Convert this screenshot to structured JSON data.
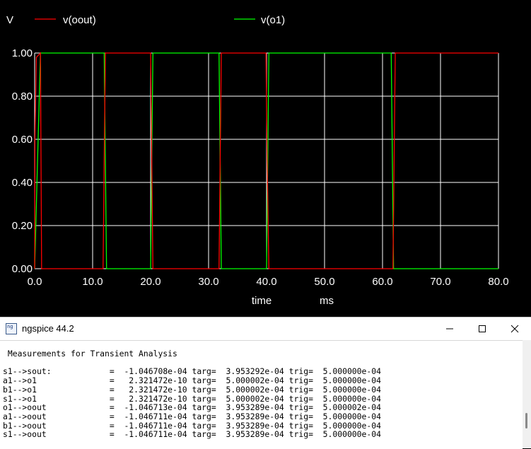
{
  "plot": {
    "y_unit": "V",
    "xlabel": "time",
    "xunit": "ms",
    "legend": [
      {
        "name": "v(oout)",
        "color": "#ff0000"
      },
      {
        "name": "v(o1)",
        "color": "#00ff00"
      }
    ],
    "yticks": [
      "1.00",
      "0.80",
      "0.60",
      "0.40",
      "0.20",
      "0.00"
    ],
    "xticks": [
      "0.0",
      "10.0",
      "20.0",
      "30.0",
      "40.0",
      "50.0",
      "60.0",
      "70.0",
      "80.0"
    ]
  },
  "chart_data": {
    "type": "line",
    "title": "",
    "xlabel": "time",
    "xunit": "ms",
    "ylabel": "V",
    "xlim": [
      0,
      80
    ],
    "ylim": [
      0,
      1
    ],
    "grid": true,
    "legend_position": "top",
    "series": [
      {
        "name": "v(oout)",
        "color": "#ff0000",
        "x": [
          0,
          0.05,
          0.3,
          1.0,
          1.2,
          11.8,
          12.0,
          12.2,
          20.0,
          20.2,
          20.4,
          31.8,
          32.0,
          32.2,
          39.9,
          40.1,
          40.4,
          61.8,
          62.0,
          62.2,
          70.0,
          80.0
        ],
        "y": [
          0,
          0.6,
          0.98,
          1.0,
          0.0,
          0.0,
          0.5,
          1.0,
          1.0,
          0.5,
          0.0,
          0.0,
          0.5,
          1.0,
          1.0,
          0.5,
          0.0,
          0.0,
          0.5,
          1.0,
          1.0,
          1.0
        ]
      },
      {
        "name": "v(o1)",
        "color": "#00ff00",
        "x": [
          0,
          0.5,
          1.0,
          12.0,
          12.2,
          12.4,
          20.0,
          20.2,
          20.4,
          31.8,
          32.0,
          32.2,
          40.0,
          40.2,
          40.4,
          61.5,
          61.7,
          61.9,
          80.0
        ],
        "y": [
          0,
          0.5,
          1.0,
          1.0,
          0.5,
          0.0,
          0.0,
          0.5,
          1.0,
          1.0,
          0.5,
          0.0,
          0.0,
          0.5,
          1.0,
          1.0,
          0.5,
          0.0,
          0.0
        ]
      }
    ]
  },
  "console": {
    "title": "ngspice 44.2",
    "header": "Measurements for Transient Analysis",
    "rows": [
      {
        "name": "s1-->sout:",
        "val": "-1.046708e-04",
        "targ": "3.953292e-04",
        "trig": "5.000000e-04"
      },
      {
        "name": "a1-->o1",
        "val": "2.321472e-10",
        "targ": "5.000002e-04",
        "trig": "5.000000e-04"
      },
      {
        "name": "b1-->o1",
        "val": "2.321472e-10",
        "targ": "5.000002e-04",
        "trig": "5.000000e-04"
      },
      {
        "name": "s1-->o1",
        "val": "2.321472e-10",
        "targ": "5.000002e-04",
        "trig": "5.000000e-04"
      },
      {
        "name": "o1-->oout",
        "val": "-1.046713e-04",
        "targ": "3.953289e-04",
        "trig": "5.000002e-04"
      },
      {
        "name": "a1-->oout",
        "val": "-1.046711e-04",
        "targ": "3.953289e-04",
        "trig": "5.000000e-04"
      },
      {
        "name": "b1-->oout",
        "val": "-1.046711e-04",
        "targ": "3.953289e-04",
        "trig": "5.000000e-04"
      },
      {
        "name": "s1-->oout",
        "val": "-1.046711e-04",
        "targ": "3.953289e-04",
        "trig": "5.000000e-04"
      }
    ]
  },
  "icons": {
    "app": "ngspice-app-icon",
    "minimize": "minimize-icon",
    "maximize": "maximize-icon",
    "close": "close-icon"
  }
}
